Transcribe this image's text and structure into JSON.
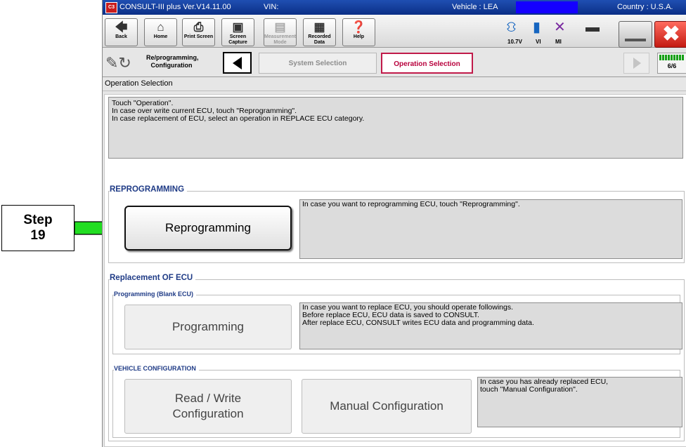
{
  "step": {
    "line1": "Step",
    "line2": "19"
  },
  "titlebar": {
    "app_name": "CONSULT-III plus  Ver.V14.11.00",
    "vin_label": "VIN:",
    "vehicle_label": "Vehicle : LEA",
    "country": "Country : U.S.A."
  },
  "toolbar": {
    "buttons": [
      {
        "label": "Back",
        "icon": "back-arrow-icon"
      },
      {
        "label": "Home",
        "icon": "home-icon"
      },
      {
        "label": "Print Screen",
        "icon": "printer-icon"
      },
      {
        "label": "Screen Capture",
        "icon": "camera-icon"
      },
      {
        "label": "Measurement Mode",
        "icon": "meter-icon"
      },
      {
        "label": "Recorded Data",
        "icon": "recorded-data-icon"
      },
      {
        "label": "Help",
        "icon": "help-icon"
      }
    ],
    "battery_voltage": "10.7V",
    "vi_label": "VI",
    "mi_label": "MI"
  },
  "nav": {
    "section_title": "Re/programming, Configuration",
    "crumb_inactive": "System Selection",
    "crumb_active": "Operation Selection",
    "progress": "6/6"
  },
  "screen_title": "Operation Selection",
  "instructions": [
    "Touch  \"Operation\".",
    "In case over write current ECU, touch \"Reprogramming\".",
    "In case replacement of ECU, select an operation in REPLACE ECU category."
  ],
  "reprogramming": {
    "group_label": "REPROGRAMMING",
    "button_label": "Reprogramming",
    "description": "In case you want to reprogramming ECU, touch \"Reprogramming\"."
  },
  "replacement": {
    "group_label": "Replacement OF ECU",
    "programming_label": "Programming (Blank ECU)",
    "programming_button": "Programming",
    "programming_desc": [
      "In case you want to replace ECU, you should operate followings.",
      "Before replace ECU, ECU data is saved to CONSULT.",
      "After replace ECU, CONSULT writes ECU data and programming data."
    ],
    "vehicle_config_label": "VEHICLE CONFIGURATION",
    "read_write_line1": "Read / Write",
    "read_write_line2": "Configuration",
    "manual_config_button": "Manual Configuration",
    "manual_desc": [
      "In case you has already replaced ECU,",
      "touch \"Manual Configuration\"."
    ]
  },
  "colors": {
    "titlebar": "#0b2f86",
    "step_arrow": "#22dd22",
    "active_crumb": "#c01a4a",
    "group_label": "#1f3b86"
  }
}
